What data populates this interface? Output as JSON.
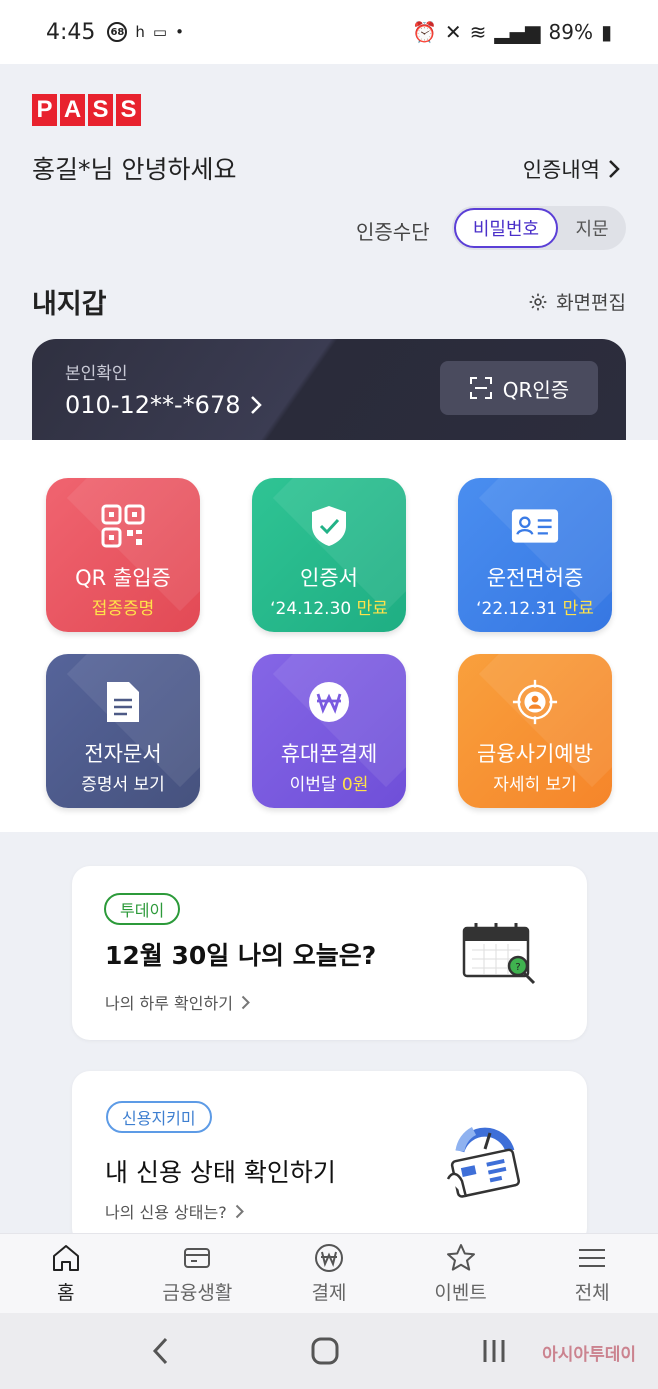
{
  "status_bar": {
    "time": "4:45",
    "badge_68": "68",
    "h_label": "h",
    "battery": "89%"
  },
  "header": {
    "logo_letters": [
      "P",
      "A",
      "S",
      "S"
    ],
    "greeting": "홍길*님 안녕하세요",
    "auth_history": "인증내역",
    "auth_method_label": "인증수단",
    "auth_option_selected": "비밀번호",
    "auth_option_other": "지문",
    "wallet_title": "내지갑",
    "screen_edit": "화면편집"
  },
  "id_card": {
    "label": "본인확인",
    "number": "010-12**-*678",
    "qr_button": "QR인증"
  },
  "tiles": [
    {
      "title": "QR 출입증",
      "sub_plain": "",
      "sub_highlight": "접종증명",
      "color": "#ea5560",
      "icon": "qr-code-icon"
    },
    {
      "title": "인증서",
      "sub_plain": "‘24.12.30 ",
      "sub_highlight": "만료",
      "color": "#23b58a",
      "icon": "shield-check-icon"
    },
    {
      "title": "운전면허증",
      "sub_plain": "‘22.12.31 ",
      "sub_highlight": "만료",
      "color": "#3e82ea",
      "icon": "id-card-icon"
    },
    {
      "title": "전자문서",
      "sub_plain": "증명서 보기",
      "sub_highlight": "",
      "color": "#4d5a86",
      "icon": "document-icon"
    },
    {
      "title": "휴대폰결제",
      "sub_plain": "이번달 ",
      "sub_highlight": "0원",
      "color": "#7a5be0",
      "icon": "won-icon"
    },
    {
      "title": "금융사기예방",
      "sub_plain": "자세히 보기",
      "sub_highlight": "",
      "color": "#f7922f",
      "icon": "target-user-icon"
    }
  ],
  "today_card": {
    "badge": "투데이",
    "title": "12월 30일 나의 오늘은?",
    "link": "나의 하루 확인하기"
  },
  "credit_card": {
    "badge": "신용지키미",
    "title": "내 신용 상태 확인하기",
    "link": "나의 신용 상태는?"
  },
  "bottom_nav": [
    {
      "label": "홈",
      "icon": "home-icon",
      "active": true
    },
    {
      "label": "금융생활",
      "icon": "card-icon",
      "active": false
    },
    {
      "label": "결제",
      "icon": "won-circle-icon",
      "active": false
    },
    {
      "label": "이벤트",
      "icon": "star-icon",
      "active": false
    },
    {
      "label": "전체",
      "icon": "menu-icon",
      "active": false
    }
  ],
  "watermark": "아시아투데이"
}
